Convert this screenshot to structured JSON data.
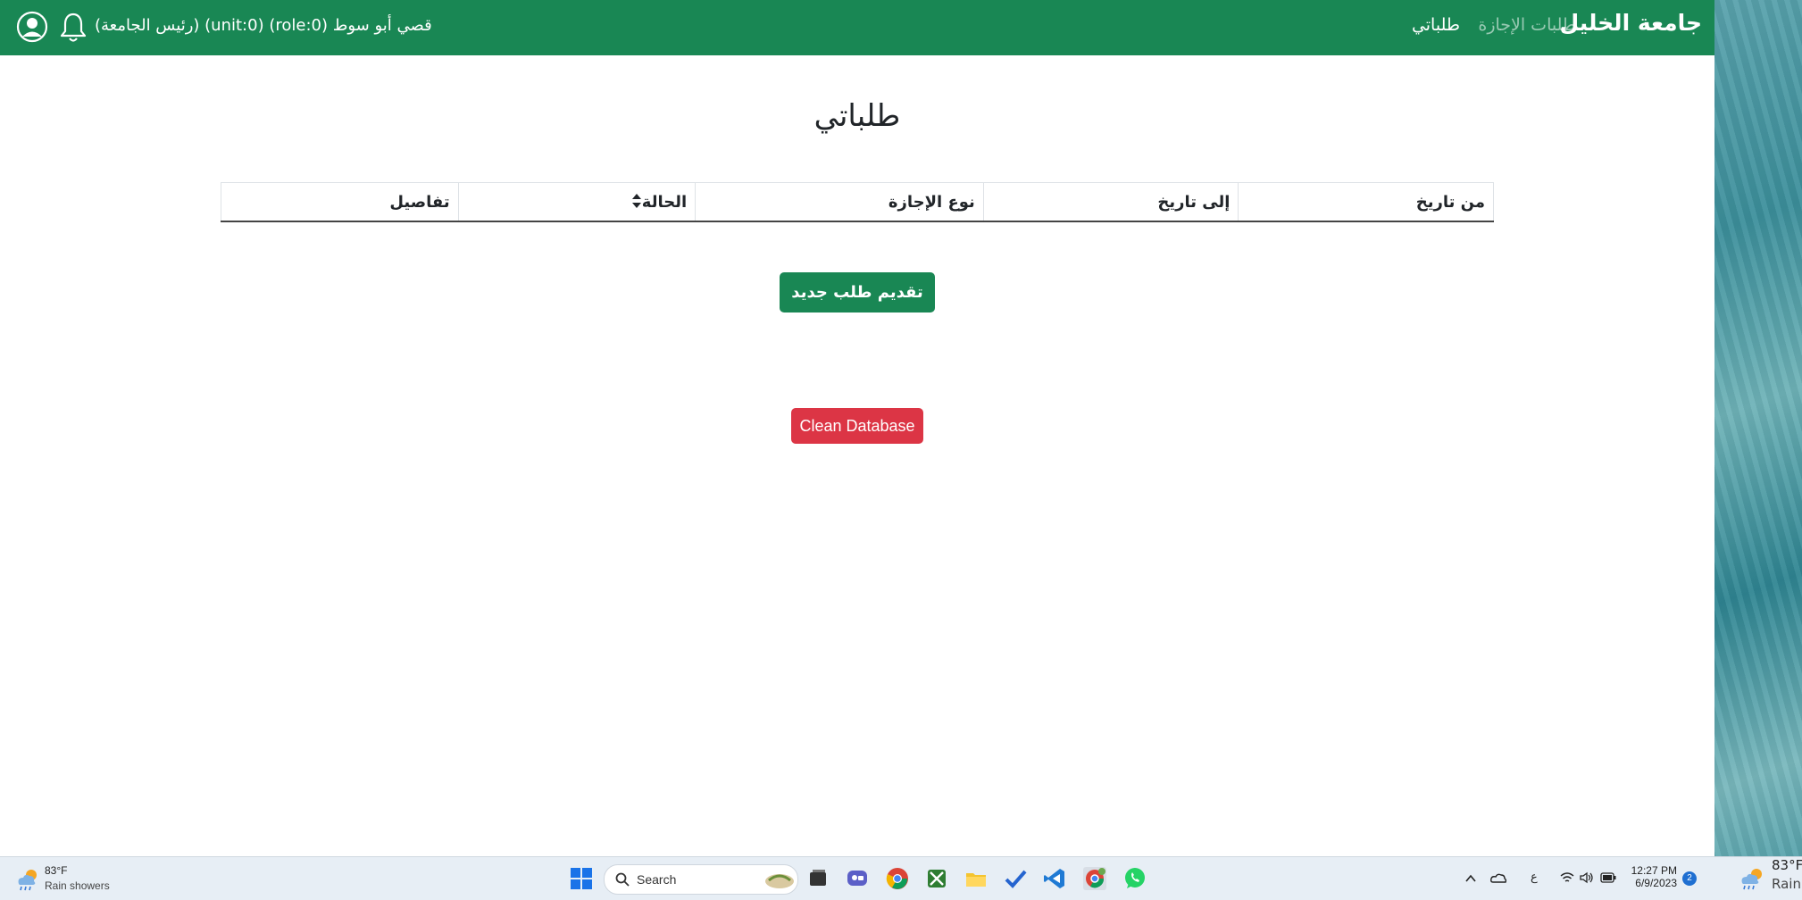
{
  "navbar": {
    "brand": "جامعة الخليل",
    "links": {
      "leave_requests": "طلبات الإجازة",
      "my_requests": "طلباتي"
    },
    "user_info": "قصي أبو سوط (role:0) (unit:0) (رئيس الجامعة)",
    "bg_color": "#198754"
  },
  "main": {
    "title": "طلباتي",
    "table": {
      "headers": [
        "من تاريخ",
        "إلى تاريخ",
        "نوع الإجازة",
        "الحالة",
        "تفاصيل"
      ],
      "rows": []
    },
    "new_request_button": "تقديم طلب جديد",
    "clean_db_button": "Clean Database",
    "danger_color": "#dc3545"
  },
  "taskbar": {
    "weather_left": {
      "temp": "83°F",
      "condition": "Rain showers"
    },
    "search_placeholder": "Search",
    "tray_lang": "ع",
    "time": "12:27 PM",
    "date": "6/9/2023",
    "notification_count": "2",
    "weather_right": {
      "temp": "83°F",
      "condition": "Rain"
    }
  }
}
